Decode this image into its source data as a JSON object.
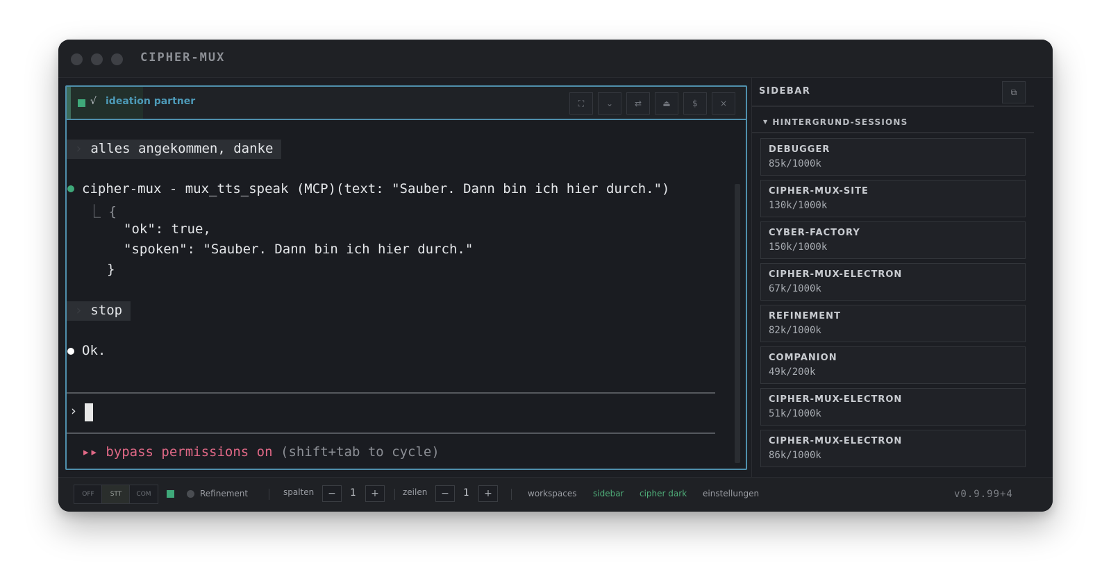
{
  "window": {
    "title": "CIPHER-MUX"
  },
  "pane": {
    "title": "ideation partner",
    "check": "√",
    "controls": [
      "⛶",
      "⌄",
      "⇄",
      "⏏",
      "$",
      "×"
    ]
  },
  "terminal": {
    "user1": "alles angekommen, danke",
    "tool_call": "cipher-mux - mux_tts_speak (MCP)(text: \"Sauber. Dann bin ich hier durch.\")",
    "result_open": "⎿ {",
    "result_ok": "\"ok\": true,",
    "result_spoken": "\"spoken\": \"Sauber. Dann bin ich hier durch.\"",
    "result_close": "}",
    "user2": "stop",
    "assistant": "Ok.",
    "prompt_symbol": "›",
    "bypass_arrows": "▸▸",
    "bypass_text": "bypass permissions on",
    "bypass_hint": "(shift+tab to cycle)"
  },
  "sidebar": {
    "title": "SIDEBAR",
    "toggle_icon": "⧉",
    "section": "HINTERGRUND-SESSIONS",
    "sessions": [
      {
        "name": "DEBUGGER",
        "tokens": "85k/1000k"
      },
      {
        "name": "CIPHER-MUX-SITE",
        "tokens": "130k/1000k"
      },
      {
        "name": "CYBER-FACTORY",
        "tokens": "150k/1000k"
      },
      {
        "name": "CIPHER-MUX-ELECTRON",
        "tokens": "67k/1000k"
      },
      {
        "name": "REFINEMENT",
        "tokens": "82k/1000k"
      },
      {
        "name": "COMPANION",
        "tokens": "49k/200k"
      },
      {
        "name": "CIPHER-MUX-ELECTRON",
        "tokens": "51k/1000k"
      },
      {
        "name": "CIPHER-MUX-ELECTRON",
        "tokens": "86k/1000k"
      }
    ]
  },
  "bottombar": {
    "modes": [
      "OFF",
      "STT",
      "COM"
    ],
    "active_mode": "STT",
    "session_label": "Refinement",
    "spalten_label": "spalten",
    "spalten_value": "1",
    "zeilen_label": "zeilen",
    "zeilen_value": "1",
    "minus": "−",
    "plus": "+",
    "links": [
      "workspaces",
      "sidebar",
      "cipher dark",
      "einstellungen"
    ],
    "version": "v0.9.99+4"
  },
  "colors": {
    "accent_blue": "#4f8fac",
    "accent_green": "#3fa97a",
    "bypass_pink": "#e06886",
    "background": "#1c1e23"
  }
}
